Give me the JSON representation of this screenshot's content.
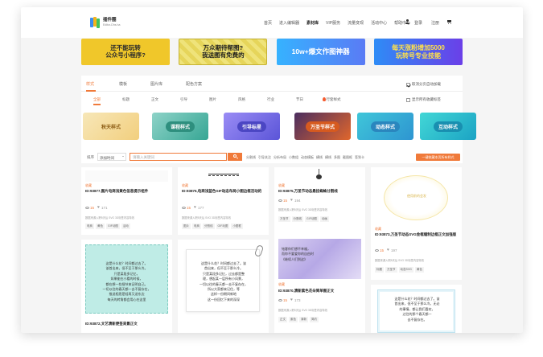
{
  "header": {
    "logo_title": "插件圈",
    "logo_subtitle": "Editor-Dhs.ha",
    "nav": [
      "首页",
      "进入编辑器",
      "素材库",
      "VIP服务",
      "流量变现",
      "活动中心",
      "帮助中心"
    ],
    "nav_active": "素材库",
    "login": "登录",
    "register": "注册",
    "accent": "#f07a3a"
  },
  "banners": [
    "还不能玩转\n公众号小程序?",
    "万众期待帮图?\n我送图有免费的",
    "10w+爆文作图神器",
    "每天涨粉增加5000\n玩转号专业技能"
  ],
  "tabs": [
    {
      "label": "样式"
    },
    {
      "label": "模板"
    },
    {
      "label": "图片库"
    },
    {
      "label": "配色方案"
    }
  ],
  "options": {
    "check_color": "取消分页自动加载",
    "check_favorites": "显示所有收藏标签"
  },
  "subtabs": [
    "全部",
    "标题",
    "正文",
    "引导",
    "图片",
    "风格",
    "行业",
    "节日",
    "行套样式"
  ],
  "categories": [
    "秋天样式",
    "课程样式",
    "引导标星",
    "万圣节样式",
    "动态样式",
    "互动样式"
  ],
  "search": {
    "sort_label": "排序",
    "sort_value": "添加时间",
    "placeholder": "请输入关键词",
    "tags": [
      "分割线",
      "引导关注",
      "分析布局",
      "小数组",
      "动态模板",
      "横线",
      "横线",
      "多图",
      "截图框",
      "签到卡"
    ],
    "collect_button": "一键收藏本页所有样式"
  },
  "cards": [
    {
      "title": "ID:93877,图片电商浅黄色信息提示组件",
      "fav": "收藏",
      "views": "15",
      "likes": "171",
      "desc": "数据来源入职5天后 SVG 3D标签内容特效",
      "tags": [
        "电商",
        "黄色",
        "GIF动图",
        "活动"
      ]
    },
    {
      "title": "ID:93876,电商浅蓝色GIF动态布局小图边框活动的",
      "fav": "收藏",
      "views": "15",
      "likes": "177",
      "desc": "数据来源入职5天后 SVG 3D标签内容特效",
      "tags": [
        "图片",
        "电商",
        "分割线",
        "GIF动图",
        "小图框"
      ]
    },
    {
      "title": "ID:93875,万圣节动态悬挂蜘蛛分割线",
      "fav": "收藏",
      "views": "15",
      "likes": "194",
      "desc": "数据来源入职5天后 SVG 3D标签内容特效",
      "tags": [
        "万圣节",
        "分割线",
        "GIF动图",
        "动画"
      ]
    },
    {
      "title": "ID:93873,万圣节动态SVG金框缝制边框正文加强版",
      "fav": "收藏",
      "views": "15",
      "likes": "197",
      "desc": "数据来源入职5天后 SVG 3D标签内容特效",
      "tags": [
        "标题",
        "万圣节",
        "动态SVG",
        "黄色"
      ],
      "preview_text": "使用前的会发"
    },
    {
      "title": "ID:93872,文艺清新便签背景正文",
      "note": "这是什么花？时间都过去了。\n该首出来，但不至于那么冷。\n只是某段多记忆，\n如果能在小看的时候，\n都在想一些细节来证明自己。\n一切以往的春天都一去不复存在，\n推送相思是轻再又送东边\n每天的转角都会用心在这里"
    },
    {
      "note": "这是什么花？时间都过去了。该\n首出来，但不至于那么冷。\n只是某段多记忆，过去都是整\n理，想起某一层所有小风景，\n一切以往的春天都一去不复存在，\n所以大家都来记住，等\n这样一份期间新地\n这一份回忆下来的深深"
    },
    {
      "title": "ID:93870,清新紫色花朵简单图正文",
      "fav": "收藏",
      "views": "15",
      "likes": "173",
      "desc": "数据来源入职5天后 SVG 3D标签内容特效",
      "tags": [
        "正文",
        "紫色",
        "清新",
        "简约"
      ],
      "note": "铭客你们想不幸福，\n而你不要爱你的自由时\n《继续人们到这》"
    },
    {
      "note": "这是什么花？时间都过去了。该\n首出来，但不至于那么冷。无论\n的事情，都让我们喜欢，\n过往的那个春天都一\n去不复存在。"
    }
  ]
}
